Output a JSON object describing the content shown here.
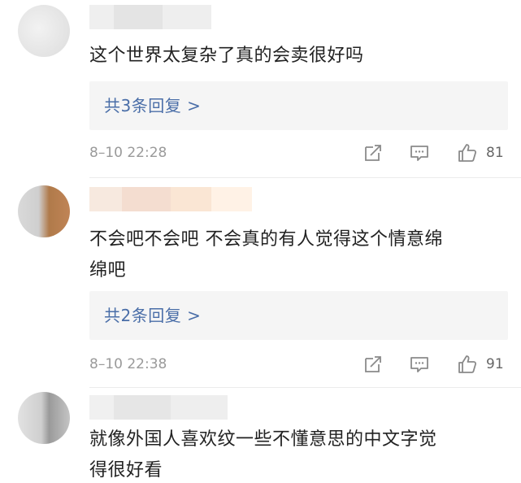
{
  "comments": [
    {
      "text_lines": [
        "这个世界太复杂了真的会卖很好吗"
      ],
      "replies_label": "共3条回复 >",
      "time": "8–10 22:28",
      "like_count": "81"
    },
    {
      "text_lines": [
        "不会吧不会吧 不会真的有人觉得这个情意绵",
        "绵吧"
      ],
      "replies_label": "共2条回复 >",
      "time": "8–10 22:38",
      "like_count": "91"
    },
    {
      "text_lines": [
        "就像外国人喜欢纹一些不懂意思的中文字觉",
        "得很好看"
      ]
    }
  ],
  "icons": {
    "share": "share-icon",
    "comment": "comment-icon",
    "like": "thumbs-up-icon"
  },
  "colors": {
    "reply_link": "#4a6ea8",
    "meta_text": "#9a9a9a",
    "reply_box_bg": "#f5f5f5"
  }
}
